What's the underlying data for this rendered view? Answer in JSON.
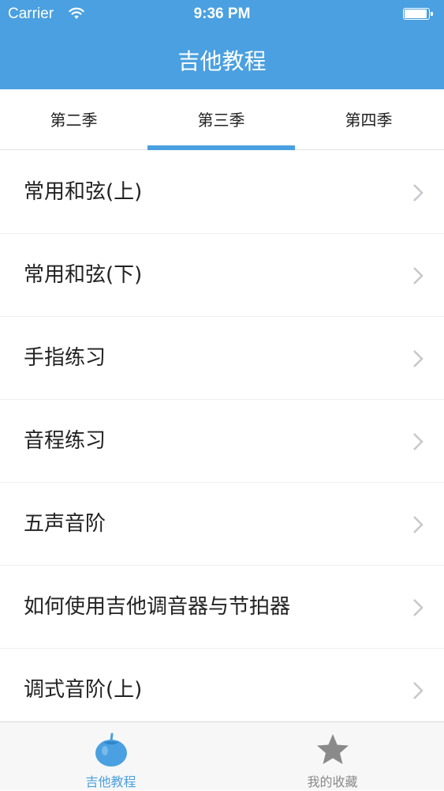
{
  "status_bar": {
    "carrier": "Carrier",
    "time": "9:36 PM"
  },
  "nav": {
    "title": "吉他教程"
  },
  "season_tabs": [
    {
      "label": "第二季",
      "selected": false
    },
    {
      "label": "第三季",
      "selected": true
    },
    {
      "label": "第四季",
      "selected": false
    }
  ],
  "lessons": [
    {
      "title": "常用和弦(上)"
    },
    {
      "title": "常用和弦(下)"
    },
    {
      "title": "手指练习"
    },
    {
      "title": "音程练习"
    },
    {
      "title": "五声音阶"
    },
    {
      "title": "如何使用吉他调音器与节拍器"
    },
    {
      "title": "调式音阶(上)"
    }
  ],
  "tabbar": [
    {
      "label": "吉他教程",
      "icon": "tomato-icon",
      "active": true
    },
    {
      "label": "我的收藏",
      "icon": "star-icon",
      "active": false
    }
  ],
  "colors": {
    "accent": "#4aa0e0",
    "inactive": "#8a8a8a"
  }
}
